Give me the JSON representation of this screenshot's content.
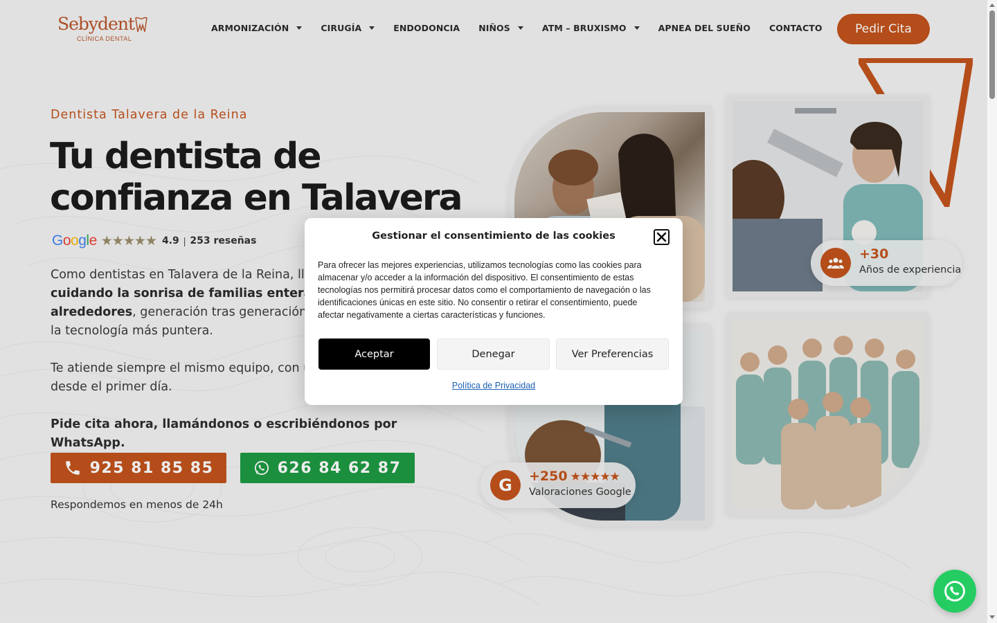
{
  "header": {
    "logo_brand": "Sebydent",
    "logo_sub": "CLÍNICA DENTAL",
    "nav": [
      {
        "label": "ARMONIZACIÓN",
        "has_dropdown": true
      },
      {
        "label": "CIRUGÍA",
        "has_dropdown": true
      },
      {
        "label": "ENDODONCIA",
        "has_dropdown": false
      },
      {
        "label": "NIÑOS",
        "has_dropdown": true
      },
      {
        "label": "ATM – BRUXISMO",
        "has_dropdown": true
      },
      {
        "label": "APNEA DEL SUEÑO",
        "has_dropdown": false
      },
      {
        "label": "CONTACTO",
        "has_dropdown": false
      }
    ],
    "cta_label": "Pedir Cita"
  },
  "hero": {
    "kicker": "Dentista Talavera de la Reina",
    "title_line1": "Tu dentista de",
    "title_line2": "confianza en Talavera",
    "rating": {
      "google_word": "Google",
      "stars": "★★★★★",
      "score": "4.9",
      "separator": "|",
      "count": "253 reseñas"
    },
    "p1_start": "Como dentistas en Talavera de la Reina, llev",
    "p1_bold_1": "cuidando la sonrisa de familias enteras de",
    "p1_bold_2": "alrededores",
    "p1_end": ", generación tras generación, c",
    "p1_line4": "la tecnología más puntera.",
    "p2_line1": "Te atiende siempre el mismo equipo, con u",
    "p2_line2": "desde el primer día.",
    "p3": "Pide cita ahora, llamándonos o escribiéndonos por WhatsApp.",
    "phone": "925 81 85 85",
    "whatsapp": "626 84 62 87",
    "respond": "Respondemos en menos de 24h"
  },
  "badges": {
    "experience_value": "+30",
    "experience_label": "Años de experiencia",
    "google_letter": "G",
    "google_value": "+250",
    "google_stars": "★★★★★",
    "google_label": "Valoraciones Google"
  },
  "cookie_modal": {
    "title": "Gestionar el consentimiento de las cookies",
    "body": "Para ofrecer las mejores experiencias, utilizamos tecnologías como las cookies para almacenar y/o acceder a la información del dispositivo. El consentimiento de estas tecnologías nos permitirá procesar datos como el comportamiento de navegación o las identificaciones únicas en este sitio. No consentir o retirar el consentimiento, puede afectar negativamente a ciertas características y funciones.",
    "accept": "Aceptar",
    "deny": "Denegar",
    "preferences": "Ver Preferencias",
    "privacy_link": "Política de Privacidad"
  },
  "colors": {
    "brand_orange": "#c2531d",
    "whatsapp_green": "#1e9a43",
    "whatsapp_float": "#25cc62",
    "background": "#f3f3f3"
  }
}
